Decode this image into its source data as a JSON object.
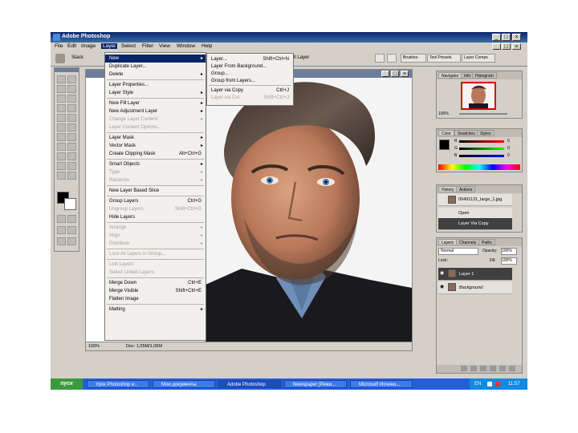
{
  "window": {
    "title": "Adobe Photoshop"
  },
  "menubar": {
    "items": [
      "File",
      "Edit",
      "Image",
      "Layer",
      "Select",
      "Filter",
      "View",
      "Window",
      "Help"
    ],
    "active": "Layer"
  },
  "options_bar": {
    "tool_label": "Stack",
    "blend_label": "ll Layer",
    "workspace_buttons": [
      "Brushes",
      "Tool Presets",
      "Layer Comps"
    ]
  },
  "layer_menu": {
    "items": [
      {
        "label": "New",
        "shortcut": "",
        "submenu": true,
        "highlighted": true,
        "disabled": false
      },
      {
        "label": "Duplicate Layer...",
        "shortcut": "",
        "submenu": false,
        "disabled": false
      },
      {
        "label": "Delete",
        "shortcut": "",
        "submenu": true,
        "disabled": false
      },
      {
        "sep": true
      },
      {
        "label": "Layer Properties...",
        "shortcut": "",
        "submenu": false,
        "disabled": false
      },
      {
        "label": "Layer Style",
        "shortcut": "",
        "submenu": true,
        "disabled": false
      },
      {
        "sep": true
      },
      {
        "label": "New Fill Layer",
        "shortcut": "",
        "submenu": true,
        "disabled": false
      },
      {
        "label": "New Adjustment Layer",
        "shortcut": "",
        "submenu": true,
        "disabled": false
      },
      {
        "label": "Change Layer Content",
        "shortcut": "",
        "submenu": true,
        "disabled": true
      },
      {
        "label": "Layer Content Options...",
        "shortcut": "",
        "submenu": false,
        "disabled": true
      },
      {
        "sep": true
      },
      {
        "label": "Layer Mask",
        "shortcut": "",
        "submenu": true,
        "disabled": false
      },
      {
        "label": "Vector Mask",
        "shortcut": "",
        "submenu": true,
        "disabled": false
      },
      {
        "label": "Create Clipping Mask",
        "shortcut": "Alt+Ctrl+G",
        "submenu": false,
        "disabled": false
      },
      {
        "sep": true
      },
      {
        "label": "Smart Objects",
        "shortcut": "",
        "submenu": true,
        "disabled": false
      },
      {
        "label": "Type",
        "shortcut": "",
        "submenu": true,
        "disabled": true
      },
      {
        "label": "Rasterize",
        "shortcut": "",
        "submenu": true,
        "disabled": true
      },
      {
        "sep": true
      },
      {
        "label": "New Layer Based Slice",
        "shortcut": "",
        "submenu": false,
        "disabled": false
      },
      {
        "sep": true
      },
      {
        "label": "Group Layers",
        "shortcut": "Ctrl+G",
        "submenu": false,
        "disabled": false
      },
      {
        "label": "Ungroup Layers",
        "shortcut": "Shift+Ctrl+G",
        "submenu": false,
        "disabled": true
      },
      {
        "label": "Hide Layers",
        "shortcut": "",
        "submenu": false,
        "disabled": false
      },
      {
        "sep": true
      },
      {
        "label": "Arrange",
        "shortcut": "",
        "submenu": true,
        "disabled": true
      },
      {
        "label": "Align",
        "shortcut": "",
        "submenu": true,
        "disabled": true
      },
      {
        "label": "Distribute",
        "shortcut": "",
        "submenu": true,
        "disabled": true
      },
      {
        "sep": true
      },
      {
        "label": "Lock All Layers in Group...",
        "shortcut": "",
        "submenu": false,
        "disabled": true
      },
      {
        "sep": true
      },
      {
        "label": "Link Layers",
        "shortcut": "",
        "submenu": false,
        "disabled": true
      },
      {
        "label": "Select Linked Layers",
        "shortcut": "",
        "submenu": false,
        "disabled": true
      },
      {
        "sep": true
      },
      {
        "label": "Merge Down",
        "shortcut": "Ctrl+E",
        "submenu": false,
        "disabled": false
      },
      {
        "label": "Merge Visible",
        "shortcut": "Shift+Ctrl+E",
        "submenu": false,
        "disabled": false
      },
      {
        "label": "Flatten Image",
        "shortcut": "",
        "submenu": false,
        "disabled": false
      },
      {
        "sep": true
      },
      {
        "label": "Matting",
        "shortcut": "",
        "submenu": true,
        "disabled": false
      }
    ]
  },
  "new_submenu": {
    "items": [
      {
        "label": "Layer...",
        "shortcut": "Shift+Ctrl+N",
        "disabled": false
      },
      {
        "label": "Layer From Background...",
        "shortcut": "",
        "disabled": false
      },
      {
        "label": "Group...",
        "shortcut": "",
        "disabled": false
      },
      {
        "label": "Group from Layers...",
        "shortcut": "",
        "disabled": false
      },
      {
        "sep": true
      },
      {
        "label": "Layer via Copy",
        "shortcut": "Ctrl+J",
        "disabled": false
      },
      {
        "label": "Layer via Cut",
        "shortcut": "Shift+Ctrl+J",
        "disabled": true
      }
    ]
  },
  "document": {
    "status_zoom": "100%",
    "status_doc": "Doc: 1,05M/1,05M"
  },
  "navigator": {
    "tabs": [
      "Navigator",
      "Info",
      "Histogram"
    ],
    "zoom": "100%"
  },
  "color": {
    "tabs": [
      "Color",
      "Swatches",
      "Styles"
    ],
    "channels": [
      "R",
      "G",
      "B"
    ],
    "values": [
      "0",
      "0",
      "0"
    ]
  },
  "history": {
    "tabs": [
      "History",
      "Actions"
    ],
    "file": "00491131_large_1.jpg",
    "steps": [
      "Open",
      "Layer Via Copy"
    ]
  },
  "layers": {
    "tabs": [
      "Layers",
      "Channels",
      "Paths"
    ],
    "blend_mode": "Normal",
    "opacity_label": "Opacity:",
    "opacity": "100%",
    "lock_label": "Lock:",
    "fill_label": "Fill:",
    "fill": "100%",
    "rows": [
      "Layer 1",
      "Background"
    ]
  },
  "taskbar": {
    "start": "пуск",
    "tasks": [
      "Урок Photoshop и...",
      "Мои документы",
      "Adobe Photoshop",
      "Newspaper [Режи...",
      "Microsoft Исчино..."
    ],
    "clock": "11:57",
    "lang": "EN"
  },
  "colors": {
    "accent": "#0a246a",
    "taskbar": "#245edb",
    "ui_gray": "#d4d0c8"
  }
}
